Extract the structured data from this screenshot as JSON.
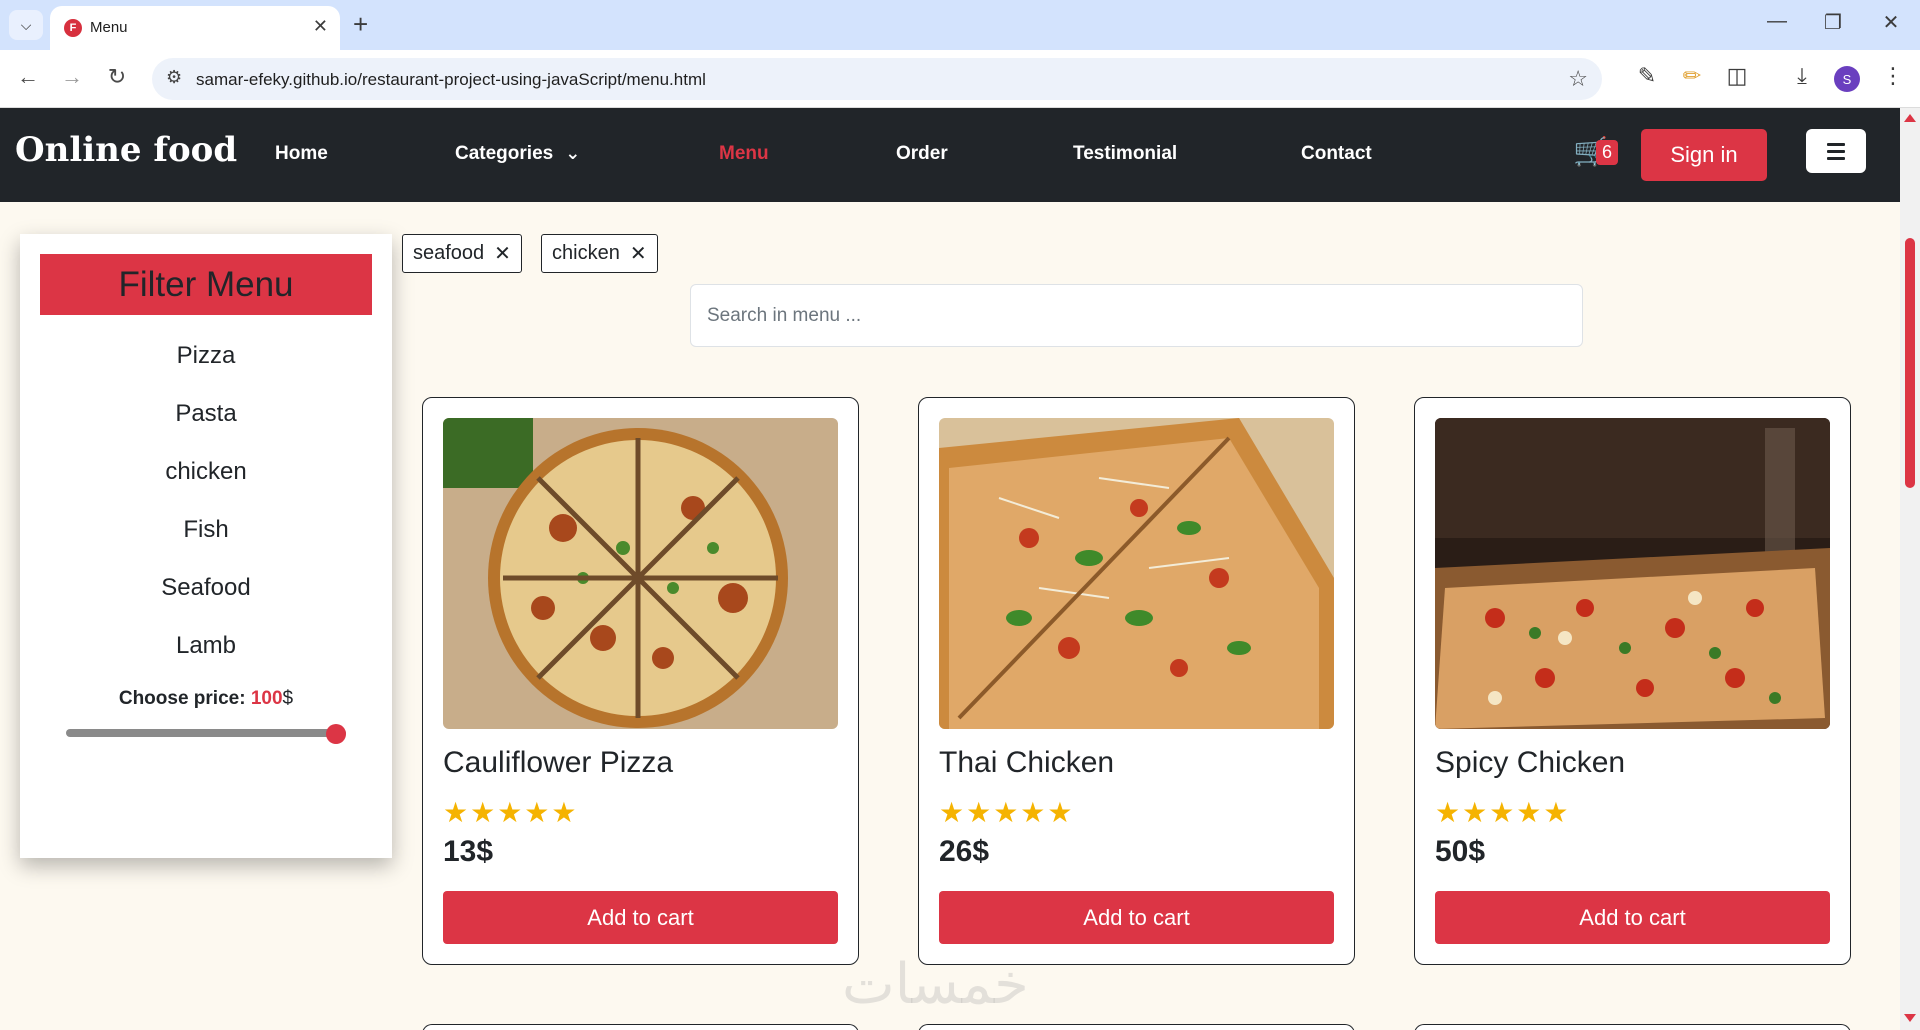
{
  "browser": {
    "tab_title": "Menu",
    "tab_favicon_letter": "F",
    "url": "samar-efeky.github.io/restaurant-project-using-javaScript/menu.html",
    "profile_initial": "S"
  },
  "navbar": {
    "brand": "Online food",
    "links": [
      "Home",
      "Categories",
      "Menu",
      "Order",
      "Testimonial",
      "Contact"
    ],
    "active": "Menu",
    "cart_count": "6",
    "signin_label": "Sign in"
  },
  "filter": {
    "title": "Filter Menu",
    "items": [
      "Pizza",
      "Pasta",
      "chicken",
      "Fish",
      "Seafood",
      "Lamb"
    ],
    "price_label": "Choose price:",
    "price_value": "100",
    "price_unit": "$",
    "price_slider_fraction": 1.0
  },
  "tags": [
    "seafood",
    "chicken"
  ],
  "search": {
    "placeholder": "Search in menu ..."
  },
  "products": [
    {
      "name": "Cauliflower Pizza",
      "rating": 5,
      "price": "13$",
      "button": "Add to cart"
    },
    {
      "name": "Thai Chicken",
      "rating": 5,
      "price": "26$",
      "button": "Add to cart"
    },
    {
      "name": "Spicy Chicken",
      "rating": 5,
      "price": "50$",
      "button": "Add to cart"
    }
  ],
  "colors": {
    "accent": "#dc3545",
    "navbar": "#212529",
    "star": "#f5b301",
    "page_bg": "#fdf9f0"
  }
}
